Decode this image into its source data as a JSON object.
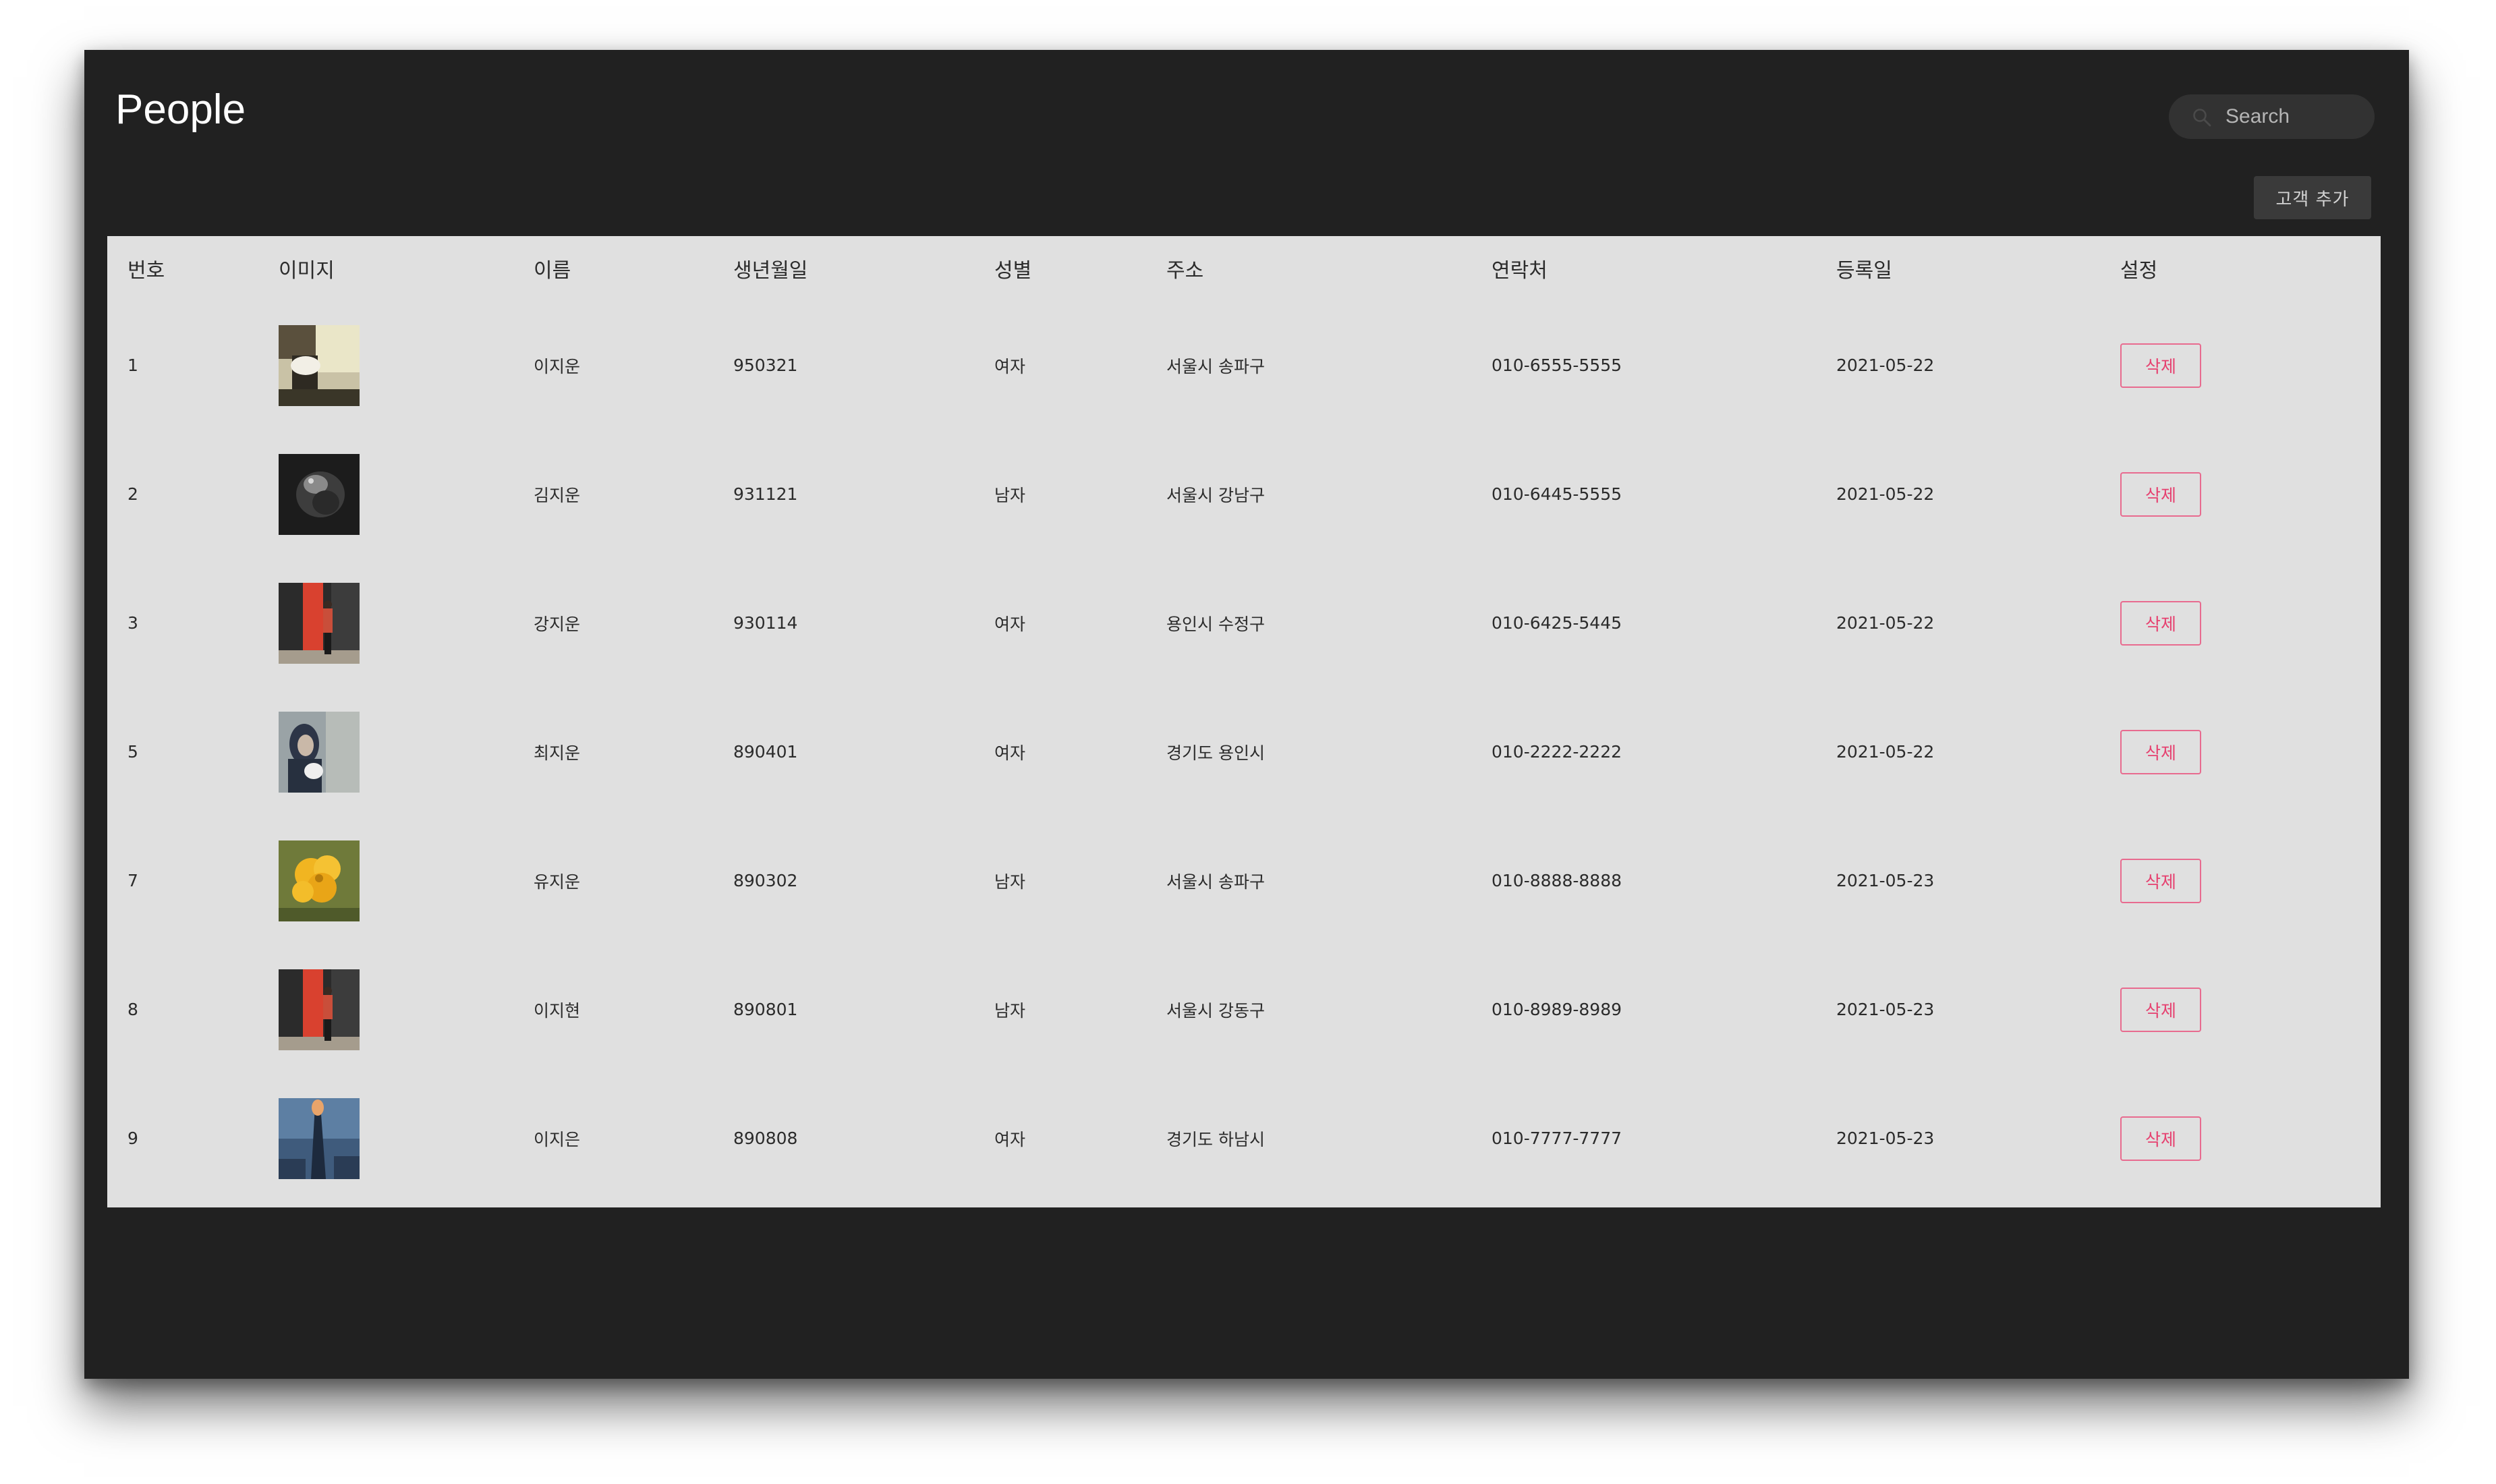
{
  "header": {
    "title": "People",
    "search_placeholder": "Search",
    "search_icon": "search-icon"
  },
  "toolbar": {
    "add_customer_label": "고객 추가"
  },
  "table": {
    "columns": [
      "번호",
      "이미지",
      "이름",
      "생년월일",
      "성별",
      "주소",
      "연락처",
      "등록일",
      "설정"
    ],
    "rows": [
      {
        "id": "1",
        "image": "photo-1",
        "name": "이지운",
        "birth": "950321",
        "gender": "여자",
        "address": "서울시 송파구",
        "phone": "010-6555-5555",
        "registered": "2021-05-22",
        "action": "삭제"
      },
      {
        "id": "2",
        "image": "photo-2",
        "name": "김지운",
        "birth": "931121",
        "gender": "남자",
        "address": "서울시 강남구",
        "phone": "010-6445-5555",
        "registered": "2021-05-22",
        "action": "삭제"
      },
      {
        "id": "3",
        "image": "photo-3",
        "name": "강지운",
        "birth": "930114",
        "gender": "여자",
        "address": "용인시 수정구",
        "phone": "010-6425-5445",
        "registered": "2021-05-22",
        "action": "삭제"
      },
      {
        "id": "5",
        "image": "photo-4",
        "name": "최지운",
        "birth": "890401",
        "gender": "여자",
        "address": "경기도 용인시",
        "phone": "010-2222-2222",
        "registered": "2021-05-22",
        "action": "삭제"
      },
      {
        "id": "7",
        "image": "photo-5",
        "name": "유지운",
        "birth": "890302",
        "gender": "남자",
        "address": "서울시 송파구",
        "phone": "010-8888-8888",
        "registered": "2021-05-23",
        "action": "삭제"
      },
      {
        "id": "8",
        "image": "photo-6",
        "name": "이지현",
        "birth": "890801",
        "gender": "남자",
        "address": "서울시 강동구",
        "phone": "010-8989-8989",
        "registered": "2021-05-23",
        "action": "삭제"
      },
      {
        "id": "9",
        "image": "photo-7",
        "name": "이지은",
        "birth": "890808",
        "gender": "여자",
        "address": "경기도 하남시",
        "phone": "010-7777-7777",
        "registered": "2021-05-23",
        "action": "삭제"
      }
    ]
  },
  "colors": {
    "window_bg": "#212121",
    "table_bg": "#e0e0e0",
    "delete_accent": "#e6406f"
  }
}
